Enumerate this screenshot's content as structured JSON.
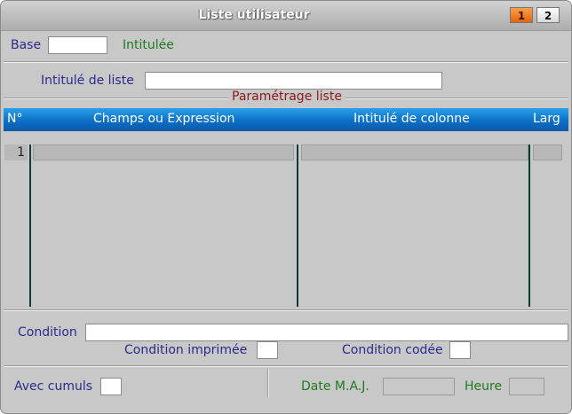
{
  "window": {
    "title": "Liste utilisateur",
    "tabs": [
      "1",
      "2"
    ]
  },
  "header": {
    "base_label": "Base",
    "base_value": "",
    "intitulee_label": "Intitulée"
  },
  "list": {
    "title_label": "Intitulé de liste",
    "title_value": ""
  },
  "settings": {
    "legend": "Paramétrage liste",
    "columns": [
      "N°",
      "Champs ou Expression",
      "Intitulé de colonne",
      "Larg"
    ],
    "rows": [
      {
        "num": "1",
        "field": "",
        "column_title": "",
        "width": ""
      }
    ]
  },
  "condition": {
    "label": "Condition",
    "value": "",
    "printed_label": "Condition imprimée",
    "coded_label": "Condition codée"
  },
  "footer": {
    "cumuls_label": "Avec cumuls",
    "date_label": "Date M.A.J.",
    "date_value": "",
    "time_label": "Heure",
    "time_value": ""
  },
  "colors": {
    "accent": "#e5650c",
    "header_blue": "#0b6cc4",
    "label_blue": "#2a2a8c",
    "label_green": "#1f7a1f",
    "legend_red": "#8b1a1a"
  }
}
